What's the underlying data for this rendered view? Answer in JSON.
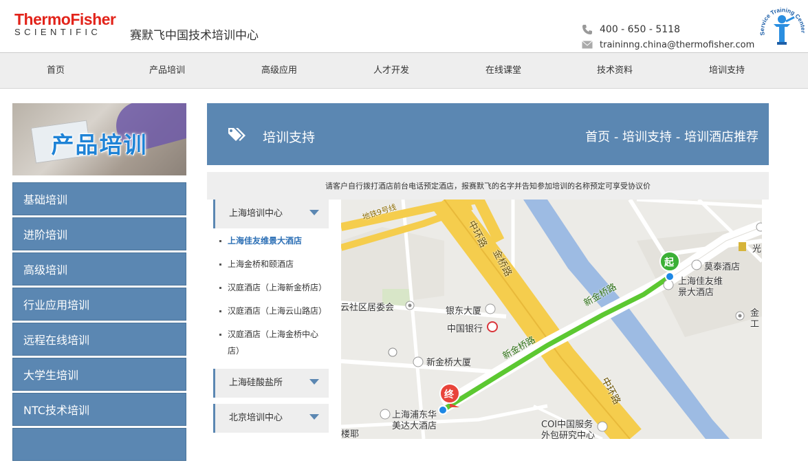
{
  "header": {
    "logo_line1": "ThermoFisher",
    "logo_line2": "SCIENTIFIC",
    "site_title": "赛默飞中国技术培训中心",
    "phone": "400 - 650 - 5118",
    "email": "traininng.china@thermofisher.com",
    "badge_text": "Service Training Center"
  },
  "nav": {
    "items": [
      "首页",
      "产品培训",
      "高级应用",
      "人才开发",
      "在线课堂",
      "技术资料",
      "培训支持"
    ]
  },
  "sidebar": {
    "banner_text": "产品培训",
    "items": [
      "基础培训",
      "进阶培训",
      "高级培训",
      "行业应用培训",
      "远程在线培训",
      "大学生培训",
      "NTC技术培训"
    ]
  },
  "main": {
    "section_title": "培训支持",
    "breadcrumb": "首页 - 培训支持 - 培训酒店推荐",
    "notice": "请客户自行拨打酒店前台电话预定酒店，报赛默飞的名字并告知参加培训的名称预定可享受协议价",
    "locations": [
      {
        "name": "上海培训中心",
        "hotels": [
          "上海佳友维景大酒店",
          "上海金桥和颐酒店",
          "汉庭酒店（上海新金桥店）",
          "汉庭酒店（上海云山路店）",
          "汉庭酒店（上海金桥中心店）"
        ],
        "active_index": 0
      },
      {
        "name": "上海硅酸盐所"
      },
      {
        "name": "北京培训中心"
      }
    ]
  },
  "map": {
    "labels": {
      "metro": "地铁9号线",
      "ring1": "中环路",
      "jinqiao": "金桥路",
      "ring2": "中环路",
      "xjq1": "新金桥路",
      "xjq2": "新金桥路",
      "motai": "莫泰酒店",
      "jiayou": "上海佳友维",
      "jiayou2": "景大酒店",
      "guang": "光",
      "jin": "金",
      "gong": "工",
      "juwei": "碧云社区居委会",
      "yindong": "银东大厦",
      "boc": "中国银行",
      "xinjinqiao": "新金桥大厦",
      "pudong1": "上海浦东华",
      "pudong2": "美达大酒店",
      "coi1": "COI中国服务",
      "coi2": "外包研究中心",
      "lou": "楼耶",
      "start": "起",
      "end": "终"
    },
    "colors": {
      "route": "#5cc831",
      "road_major": "#f5cd4d",
      "road_minor": "#ffffff",
      "river": "#9dbbe3",
      "start": "#3bb036",
      "end": "#e8443a"
    }
  }
}
